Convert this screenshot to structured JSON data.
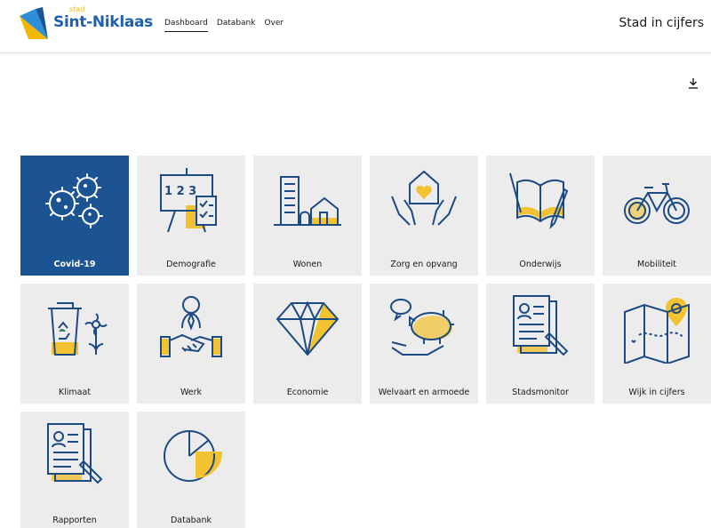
{
  "header": {
    "logo_small": "stad",
    "logo_name": "Sint-Niklaas",
    "nav": [
      {
        "label": "Dashboard",
        "active": true
      },
      {
        "label": "Databank",
        "active": false
      },
      {
        "label": "Over",
        "active": false
      }
    ],
    "site_title": "Stad in cijfers"
  },
  "tiles": [
    {
      "label": "Covid-19",
      "icon": "virus-icon",
      "selected": true
    },
    {
      "label": "Demografie",
      "icon": "presentation-board-icon",
      "selected": false
    },
    {
      "label": "Wonen",
      "icon": "buildings-icon",
      "selected": false
    },
    {
      "label": "Zorg en opvang",
      "icon": "hands-house-heart-icon",
      "selected": false
    },
    {
      "label": "Onderwijs",
      "icon": "open-book-icon",
      "selected": false
    },
    {
      "label": "Mobiliteit",
      "icon": "bicycle-icon",
      "selected": false
    },
    {
      "label": "Klimaat",
      "icon": "recycle-bin-flower-icon",
      "selected": false
    },
    {
      "label": "Werk",
      "icon": "handshake-icon",
      "selected": false
    },
    {
      "label": "Economie",
      "icon": "diamond-icon",
      "selected": false
    },
    {
      "label": "Welvaart en armoede",
      "icon": "piggy-bank-icon",
      "selected": false
    },
    {
      "label": "Stadsmonitor",
      "icon": "report-document-icon",
      "selected": false
    },
    {
      "label": "Wijk in cijfers",
      "icon": "map-pin-icon",
      "selected": false
    },
    {
      "label": "Rapporten",
      "icon": "report-document-icon",
      "selected": false
    },
    {
      "label": "Databank",
      "icon": "pie-chart-icon",
      "selected": false
    }
  ],
  "colors": {
    "primary_blue": "#1c5393",
    "accent_yellow": "#f2c230",
    "tile_gray": "#ececec"
  }
}
